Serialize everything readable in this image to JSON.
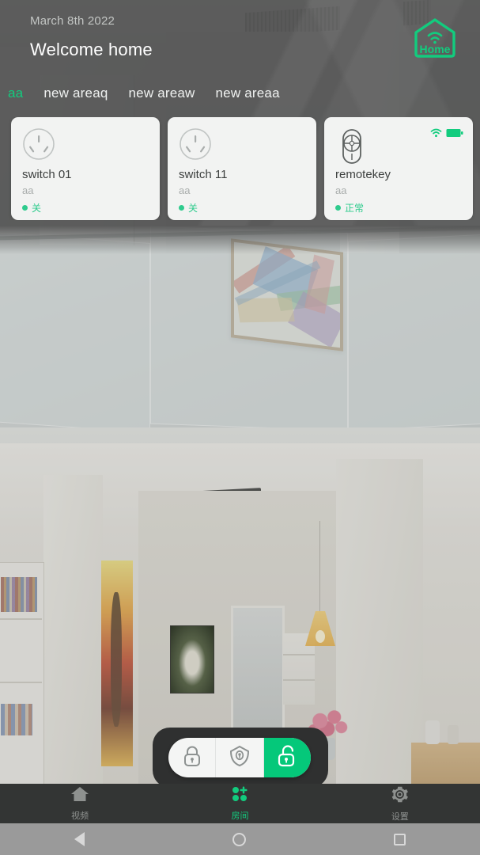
{
  "header": {
    "date": "March 8th 2022",
    "greeting": "Welcome home",
    "logo_text": "Home",
    "logo_color": "#12cc7e"
  },
  "tabs": [
    {
      "label": "aa",
      "active": true
    },
    {
      "label": "new areaq",
      "active": false
    },
    {
      "label": "new areaw",
      "active": false
    },
    {
      "label": "new areaa",
      "active": false
    }
  ],
  "devices": [
    {
      "icon": "power-socket-icon",
      "name": "switch 01",
      "area": "aa",
      "status": "关",
      "status_color": "#2ecb8d",
      "has_wifi": false,
      "has_battery": false
    },
    {
      "icon": "power-socket-icon",
      "name": "switch 11",
      "area": "aa",
      "status": "关",
      "status_color": "#2ecb8d",
      "has_wifi": false,
      "has_battery": false
    },
    {
      "icon": "remote-key-icon",
      "name": "remotekey",
      "area": "aa",
      "status": "正常",
      "status_color": "#2ecb8d",
      "has_wifi": true,
      "has_battery": true
    }
  ],
  "security": {
    "modes": [
      {
        "name": "arm-away",
        "icon": "lock-closed-icon",
        "active": false
      },
      {
        "name": "arm-home",
        "icon": "shield-lock-icon",
        "active": false
      },
      {
        "name": "disarm",
        "icon": "lock-open-icon",
        "active": true
      }
    ],
    "active_color": "#05c87a"
  },
  "bottom_nav": [
    {
      "label": "视频",
      "icon": "home-house-icon",
      "active": false
    },
    {
      "label": "房间",
      "icon": "rooms-dots-plus-icon",
      "active": true
    },
    {
      "label": "设置",
      "icon": "gear-icon",
      "active": false
    }
  ],
  "system_nav": [
    {
      "name": "back",
      "icon": "back-triangle-icon"
    },
    {
      "name": "home",
      "icon": "home-circle-icon"
    },
    {
      "name": "recents",
      "icon": "recents-square-icon"
    }
  ]
}
